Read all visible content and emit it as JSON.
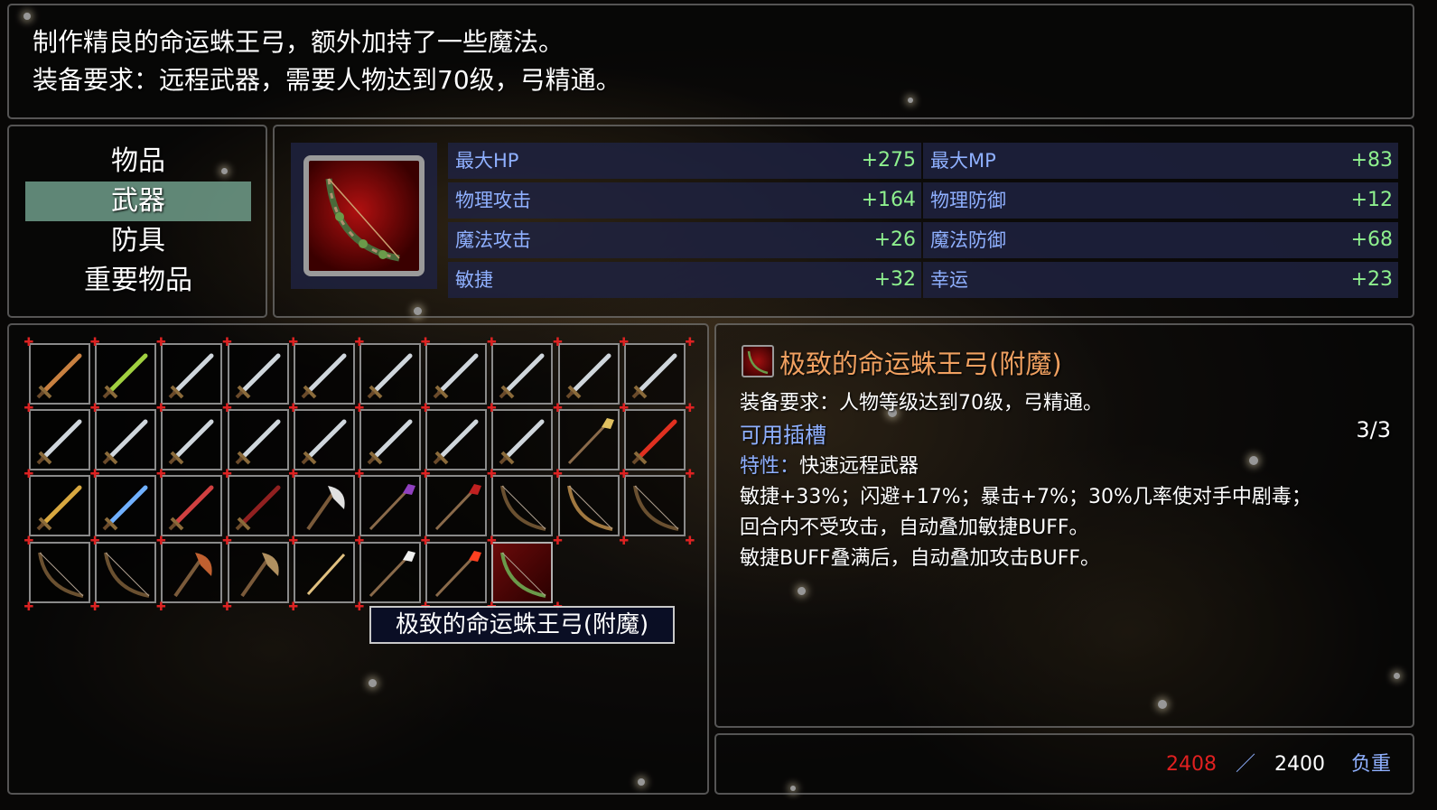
{
  "help": {
    "line1": "制作精良的命运蛛王弓，额外加持了一些魔法。",
    "line2": "装备要求：远程武器，需要人物达到70级，弓精通。"
  },
  "categories": [
    {
      "label": "物品",
      "selected": false
    },
    {
      "label": "武器",
      "selected": true
    },
    {
      "label": "防具",
      "selected": false
    },
    {
      "label": "重要物品",
      "selected": false
    }
  ],
  "stats": [
    {
      "name": "最大HP",
      "value": "+275"
    },
    {
      "name": "最大MP",
      "value": "+83"
    },
    {
      "name": "物理攻击",
      "value": "+164"
    },
    {
      "name": "物理防御",
      "value": "+12"
    },
    {
      "name": "魔法攻击",
      "value": "+26"
    },
    {
      "name": "魔法防御",
      "value": "+68"
    },
    {
      "name": "敏捷",
      "value": "+32"
    },
    {
      "name": "幸运",
      "value": "+23"
    }
  ],
  "items": [
    "bronze-sword-icon",
    "green-sword-icon",
    "steel-sword-icon",
    "steel-sword-icon",
    "steel-sword-icon",
    "steel-sword-icon",
    "steel-sword-icon",
    "steel-sword-icon",
    "steel-sword-icon",
    "steel-sword-icon",
    "steel-sword-icon",
    "steel-sword-icon",
    "steel-sword-icon",
    "steel-sword-icon",
    "steel-sword-icon",
    "steel-sword-icon",
    "steel-sword-icon",
    "steel-sword-icon",
    "gold-spear-icon",
    "red-sword-icon",
    "gold-sword-icon",
    "blue-sword-icon",
    "red-green-sword-icon",
    "dark-red-sword-icon",
    "silver-axe-icon",
    "purple-spear-icon",
    "red-spear-icon",
    "dark-bow-icon",
    "wood-bow-icon",
    "dark-bow-icon",
    "dark-bow-icon",
    "dark-bow-icon",
    "copper-axe-icon",
    "bronze-axe-icon",
    "gold-staff-icon",
    "white-spear-icon",
    "fire-spear-icon",
    "spider-bow-icon"
  ],
  "selected_index": 37,
  "tooltip": "极致的命运蛛王弓(附魔)",
  "detail": {
    "name": "极致的命运蛛王弓(附魔)",
    "requirement": "装备要求：人物等级达到70级，弓精通。",
    "slots_label": "可用插槽",
    "slots_value": "3/3",
    "trait_label": "特性：",
    "trait_value": "快速远程武器",
    "desc1": "敏捷+33%；闪避+17%；暴击+7%；30%几率使对手中剧毒；",
    "desc2": "回合内不受攻击，自动叠加敏捷BUFF。",
    "desc3": "敏捷BUFF叠满后，自动叠加攻击BUFF。"
  },
  "weight": {
    "current": "2408",
    "separator": "／",
    "max": "2400",
    "label": "负重"
  },
  "colors": {
    "selected_category": "#78aa96",
    "stat_name": "#8fb0ff",
    "stat_value": "#8ef08e",
    "item_name": "#f0a060",
    "overweight": "#e02020"
  }
}
